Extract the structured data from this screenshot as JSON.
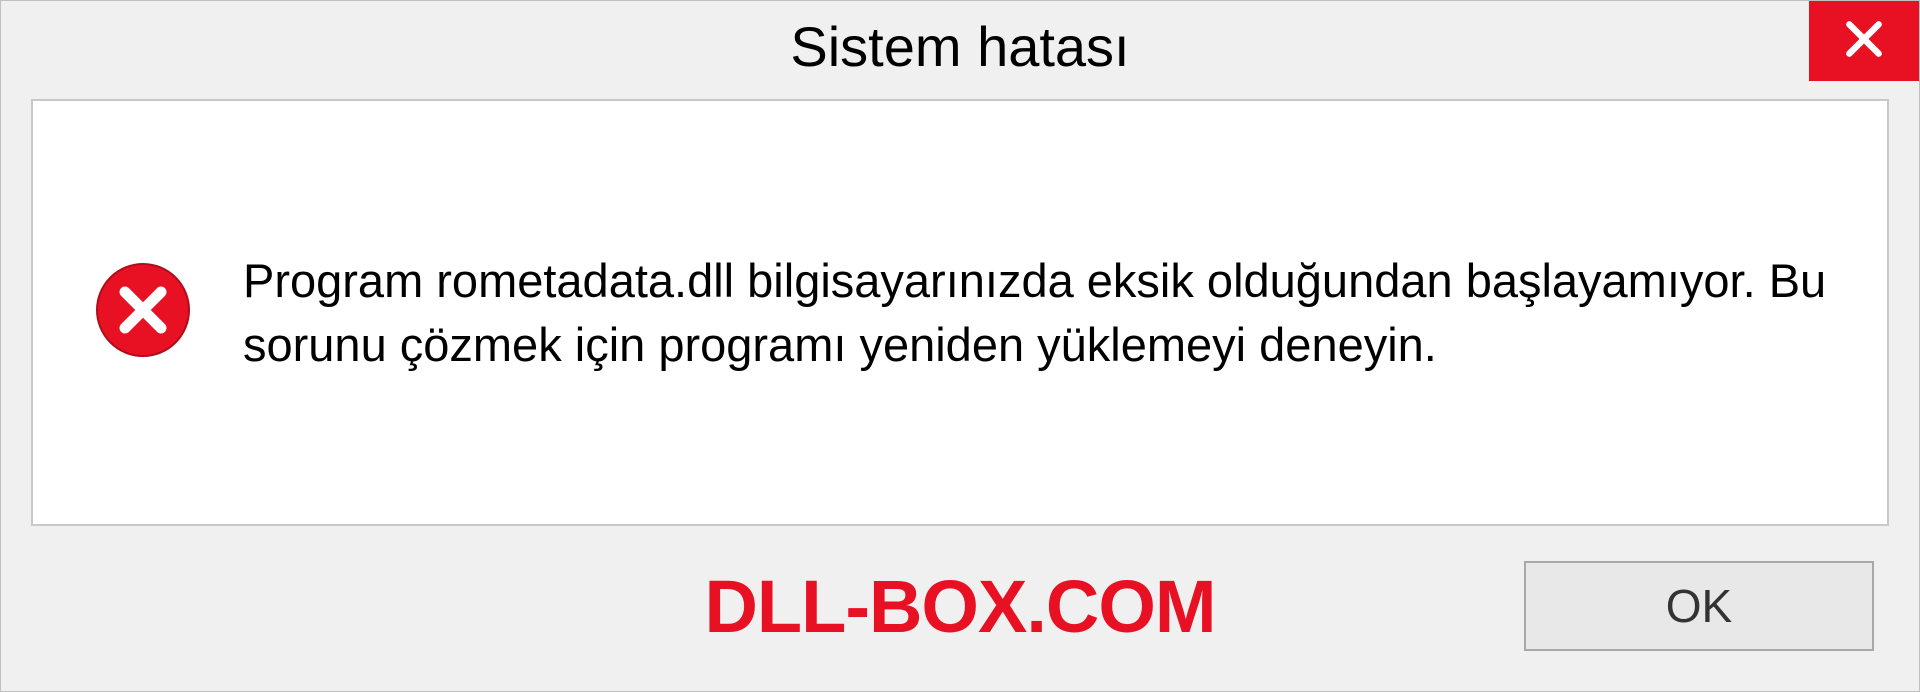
{
  "dialog": {
    "title": "Sistem hatası",
    "message": "Program rometadata.dll bilgisayarınızda eksik olduğundan başlayamıyor. Bu sorunu çözmek için programı yeniden yüklemeyi deneyin.",
    "ok_label": "OK"
  },
  "watermark": "DLL-BOX.COM"
}
